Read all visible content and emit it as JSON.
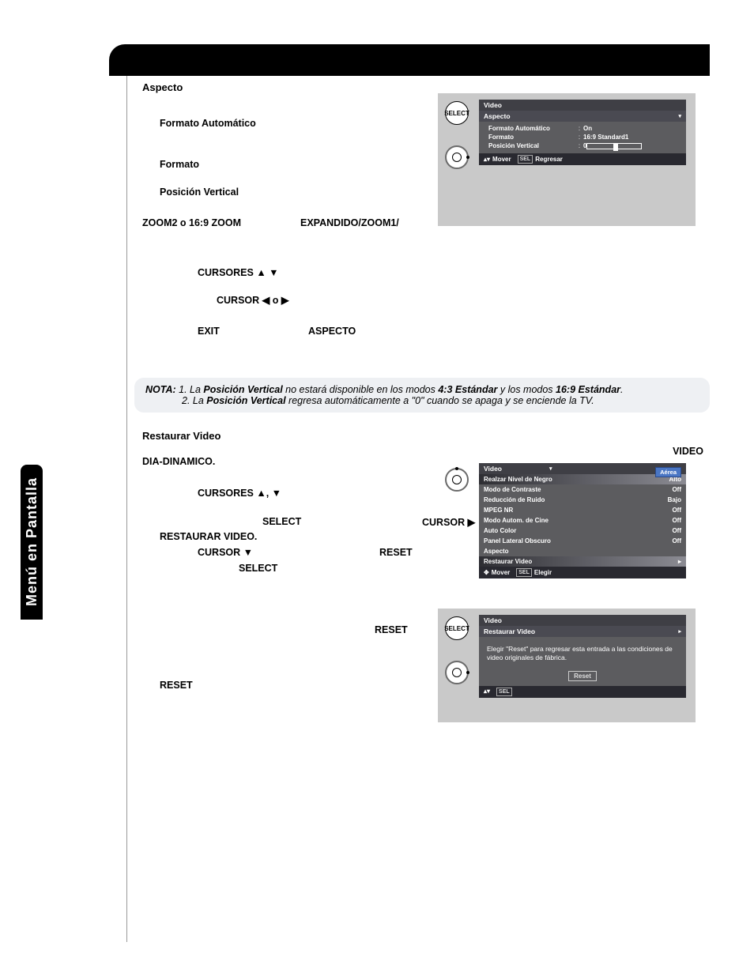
{
  "side_tab": "Menú en Pantalla",
  "aspecto": {
    "title": "Aspecto",
    "formato_auto_lbl": "Formato Automático",
    "formato_lbl": "Formato",
    "pos_vert_lbl": "Posición Vertical",
    "expandido_line_a": "EXPANDIDO/ZOOM1/",
    "expandido_line_b": "ZOOM2 o 16:9 ZOOM",
    "cursores_ud": "CURSORES ▲   ▼",
    "cursor_lr": "CURSOR  ◀ o ▶",
    "exit_lbl": "EXIT",
    "aspecto_caps": "ASPECTO"
  },
  "note": {
    "label": "NOTA:",
    "n1_a": "1.  La ",
    "n1_b": "Posición Vertical",
    "n1_c": " no estará disponible en los modos ",
    "n1_d": "4:3 Estándar",
    "n1_e": " y los modos ",
    "n1_f": "16:9 Estándar",
    "n1_g": ".",
    "n2_a": "2.  La ",
    "n2_b": "Posición Vertical",
    "n2_c": " regresa automáticamente a \"0\" cuando se apaga y se enciende la TV."
  },
  "restaurar": {
    "title": "Restaurar Video",
    "video_caps": "VIDEO",
    "dia": "DIA-DINAMICO.",
    "cursores": "CURSORES  ▲, ▼",
    "select": "SELECT",
    "cursor_r": "CURSOR  ▶",
    "restaurar_caps": "RESTAURAR VIDEO.",
    "cursor_d": "CURSOR ▼",
    "reset1": "RESET",
    "select2": "SELECT",
    "reset2": "RESET",
    "reset3": "RESET"
  },
  "osd1": {
    "icons": {
      "select": "SELECT"
    },
    "header": "Video",
    "sub": "Aspecto",
    "rows": [
      {
        "k": "Formato Automático",
        "v": "On"
      },
      {
        "k": "Formato",
        "v": "16:9  Standard1"
      },
      {
        "k": "Posición Vertical",
        "v": "0",
        "slider": true
      }
    ],
    "foot_move": "Mover",
    "foot_sel": "SEL",
    "foot_back": "Regresar"
  },
  "osd2": {
    "header": "Video",
    "badge": "Aérea",
    "rows": [
      {
        "k": "Realzar Nivel de Negro",
        "v": "Alto",
        "sel": true
      },
      {
        "k": "Modo de Contraste",
        "v": "Off"
      },
      {
        "k": "Reducción de Ruido",
        "v": "Bajo"
      },
      {
        "k": "MPEG NR",
        "v": "Off"
      },
      {
        "k": "Modo Autom. de Cine",
        "v": "Off"
      },
      {
        "k": "Auto Color",
        "v": "Off"
      },
      {
        "k": "Panel Lateral Obscuro",
        "v": "Off"
      },
      {
        "k": "Aspecto",
        "v": ""
      },
      {
        "k": "Restaurar Video",
        "v": "▸",
        "sel": true
      }
    ],
    "foot_move": "Mover",
    "foot_sel": "SEL",
    "foot_choose": "Elegir"
  },
  "osd3": {
    "icons": {
      "select": "SELECT"
    },
    "header": "Video",
    "sub": "Restaurar Video",
    "body": "Elegir \"Reset\" para regresar esta entrada a las condiciones de video originales de fábrica.",
    "reset": "Reset",
    "foot_sel": "SEL"
  }
}
